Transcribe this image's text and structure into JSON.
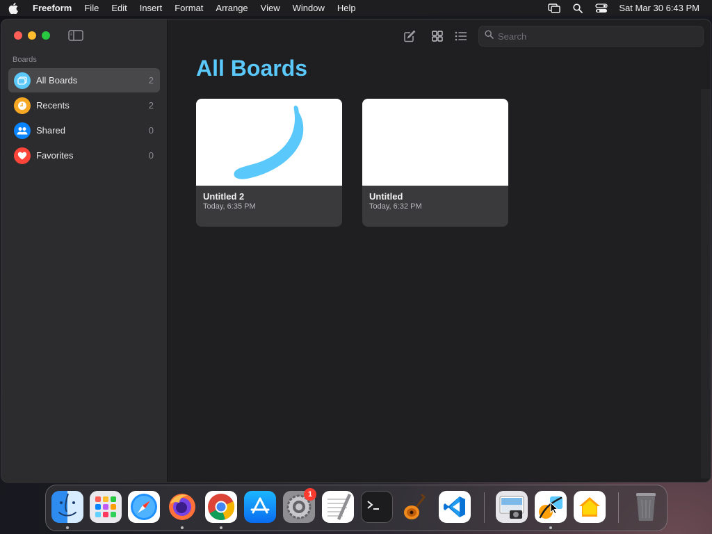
{
  "menubar": {
    "app_name": "Freeform",
    "items": [
      "File",
      "Edit",
      "Insert",
      "Format",
      "Arrange",
      "View",
      "Window",
      "Help"
    ],
    "clock": "Sat Mar 30  6:43 PM"
  },
  "sidebar": {
    "section_title": "Boards",
    "items": [
      {
        "label": "All Boards",
        "count": "2",
        "icon": "all-boards-icon",
        "color": "#5ac8fa"
      },
      {
        "label": "Recents",
        "count": "2",
        "icon": "clock-icon",
        "color": "#f7a823"
      },
      {
        "label": "Shared",
        "count": "0",
        "icon": "people-icon",
        "color": "#0a84ff"
      },
      {
        "label": "Favorites",
        "count": "0",
        "icon": "heart-icon",
        "color": "#ff453a"
      }
    ]
  },
  "main": {
    "title": "All Boards",
    "search_placeholder": "Search",
    "boards": [
      {
        "name": "Untitled 2",
        "date": "Today, 6:35 PM"
      },
      {
        "name": "Untitled",
        "date": "Today, 6:32 PM"
      }
    ]
  },
  "dock": {
    "badge_count": "1",
    "apps": [
      "Finder",
      "Launchpad",
      "Safari",
      "Firefox",
      "Chrome",
      "App Store",
      "System Settings",
      "TextEdit",
      "Terminal",
      "GarageBand",
      "Visual Studio Code",
      "Preview",
      "Freeform",
      "Home",
      "Trash"
    ]
  },
  "colors": {
    "accent": "#5ac8fa",
    "sidebar_bg": "#2c2c2e",
    "main_bg": "#1f1f21"
  }
}
